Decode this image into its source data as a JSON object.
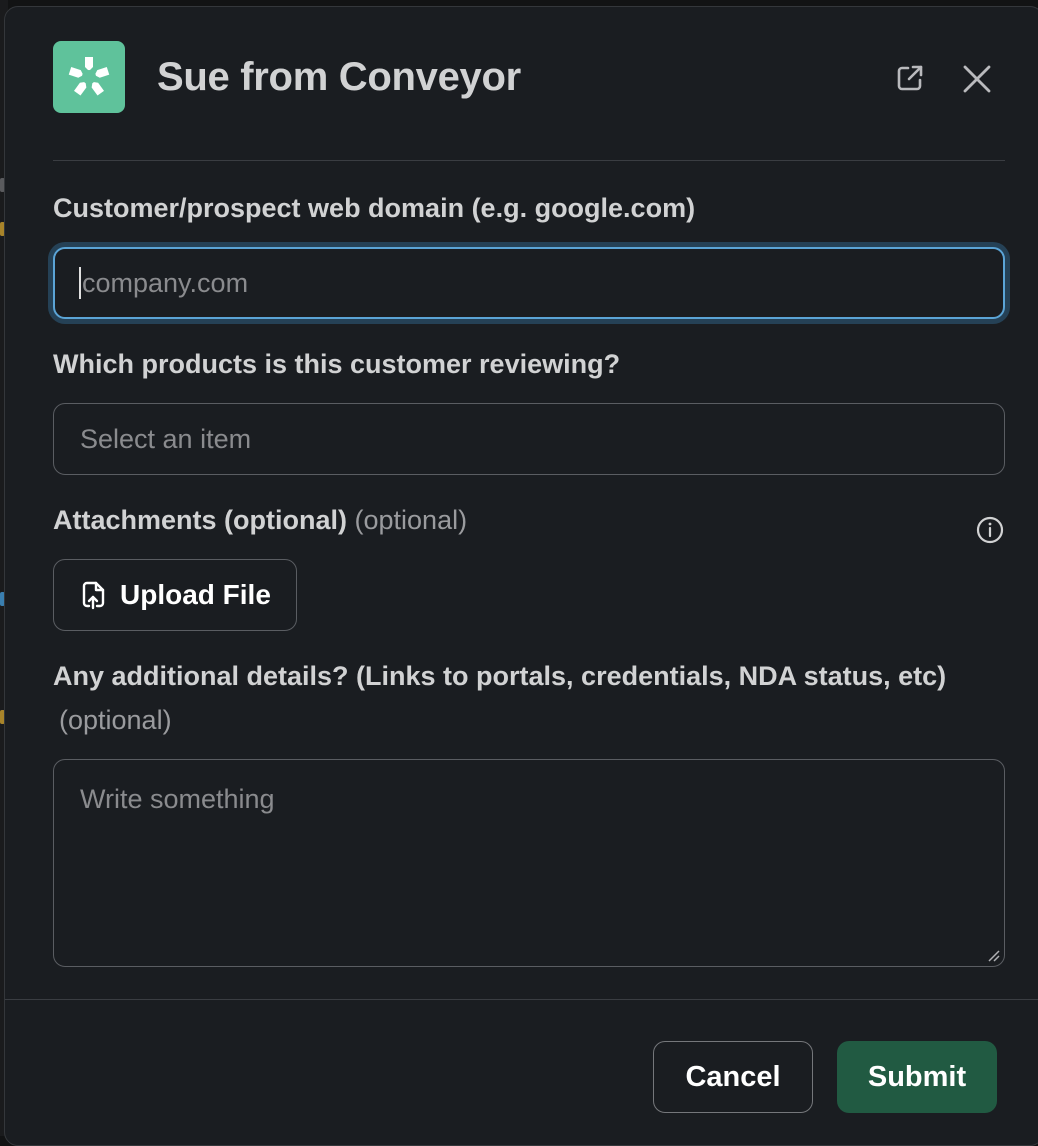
{
  "modal": {
    "title": "Sue from Conveyor",
    "logo_icon": "conveyor-logo",
    "external_link_icon": "external-link-icon",
    "close_icon": "close-icon"
  },
  "fields": {
    "domain": {
      "label": "Customer/prospect web domain (e.g. google.com)",
      "placeholder": "company.com",
      "value": ""
    },
    "products": {
      "label": "Which products is this customer reviewing?",
      "placeholder": "Select an item"
    },
    "attachments": {
      "label": "Attachments (optional)",
      "optional": "(optional)",
      "info_icon": "info-icon",
      "upload_label": "Upload File"
    },
    "details": {
      "label": "Any additional details? (Links to portals, credentials, NDA status, etc)",
      "optional": "(optional)",
      "placeholder": "Write something"
    }
  },
  "footer": {
    "cancel_label": "Cancel",
    "submit_label": "Submit"
  },
  "colors": {
    "accent_green": "#5fc29b",
    "submit_bg": "#215a42",
    "focus_ring": "#5ba4d6",
    "modal_bg": "#1a1d21"
  }
}
